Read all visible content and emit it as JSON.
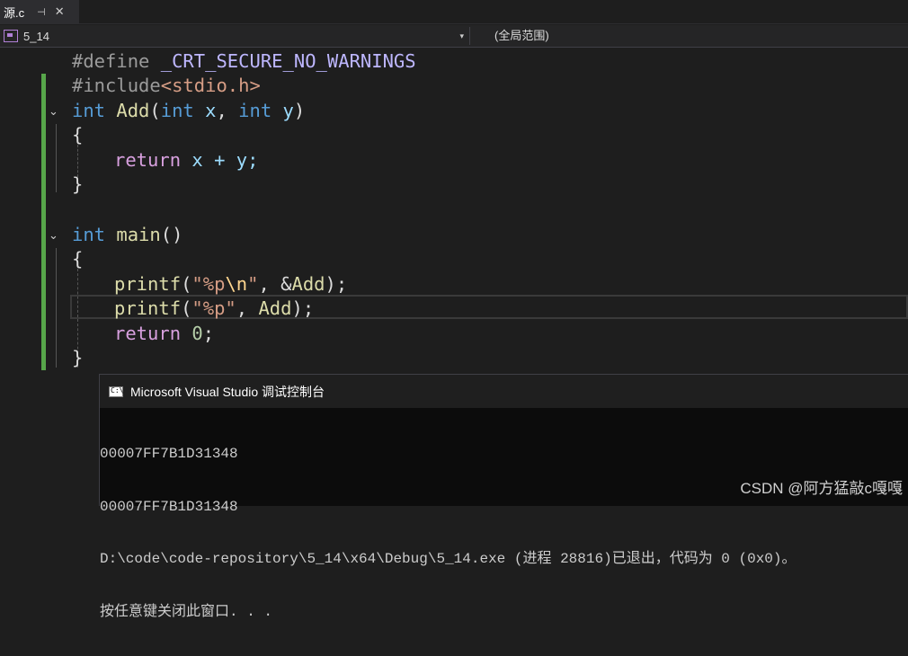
{
  "tab": {
    "label": "源.c",
    "pin": "⊣",
    "close": "✕"
  },
  "navbar": {
    "project": "5_14",
    "dropdown": "▾",
    "scope": "(全局范围)"
  },
  "code": {
    "line1": {
      "directive": "#define ",
      "macro": "_CRT_SECURE_NO_WARNINGS"
    },
    "line2": {
      "directive": "#include",
      "header": "<stdio.h>"
    },
    "line3": {
      "kw1": "int",
      "fn": "Add",
      "open": "(",
      "kw2": "int",
      "p1": "x",
      "comma": ", ",
      "kw3": "int",
      "p2": "y",
      "close": ")"
    },
    "line4": "{",
    "line5": {
      "ret": "return",
      "expr": " x + y;"
    },
    "line6": "}",
    "line8": {
      "kw": "int",
      "fn": "main",
      "rest": "()"
    },
    "line9": "{",
    "line10": {
      "fn": "printf",
      "open": "(",
      "q1": "\"%p",
      "esc": "\\n",
      "q2": "\"",
      "rest": ", &",
      "arg": "Add",
      "end": ");"
    },
    "line11": {
      "fn": "printf",
      "open": "(",
      "q1": "\"%p\"",
      "rest": ", ",
      "arg": "Add",
      "end": ");"
    },
    "line12": {
      "ret": "return",
      "num": "0",
      "end": ";"
    },
    "line13": "}"
  },
  "fold_icon": "⌄",
  "console": {
    "title": "Microsoft Visual Studio 调试控制台",
    "lines": [
      "00007FF7B1D31348",
      "00007FF7B1D31348",
      "D:\\code\\code-repository\\5_14\\x64\\Debug\\5_14.exe (进程 28816)已退出，代码为 0 (0x0)。",
      "按任意键关闭此窗口. . ."
    ]
  },
  "watermark": "CSDN @阿方猛敲c嘎嘎"
}
